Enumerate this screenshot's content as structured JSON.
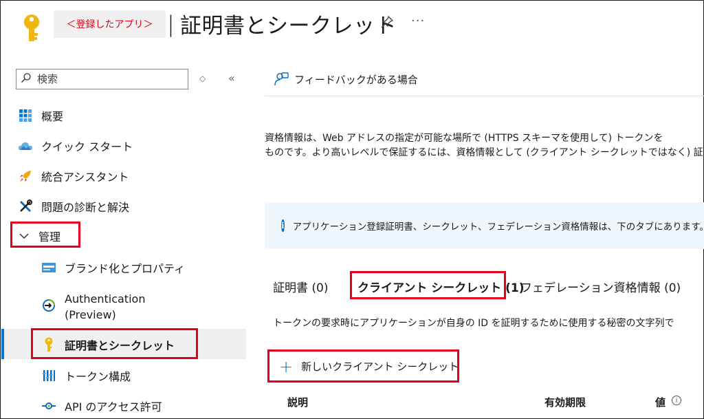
{
  "header": {
    "breadcrumb": "＜登録したアプリ＞",
    "separator": "|",
    "title": "証明書とシークレット",
    "more": "···"
  },
  "sidebar": {
    "search_placeholder": "検索",
    "updown": "◇",
    "collapse": "«",
    "items": [
      {
        "label": "概要",
        "icon": "grid-icon"
      },
      {
        "label": "クイック スタート",
        "icon": "cloud-icon"
      },
      {
        "label": "統合アシスタント",
        "icon": "rocket-icon"
      },
      {
        "label": "問題の診断と解決",
        "icon": "tools-icon"
      },
      {
        "label": "管理",
        "icon": "chevron-down-icon"
      },
      {
        "label": "ブランド化とプロパティ",
        "icon": "branding-icon"
      },
      {
        "label": "Authentication",
        "label2": "(Preview)",
        "icon": "authentication-icon"
      },
      {
        "label": "証明書とシークレット",
        "icon": "key-icon"
      },
      {
        "label": "トークン構成",
        "icon": "token-icon"
      },
      {
        "label": "API のアクセス許可",
        "icon": "api-icon"
      }
    ]
  },
  "main": {
    "feedback": "フィードバックがある場合",
    "description_line1": "資格情報は、Web アドレスの指定が可能な場所で (HTTPS スキーマを使用して) トークンを",
    "description_line2": "ものです。より高いレベルで保証するには、資格情報として (クライアント シークレットではなく) 証",
    "info": "アプリケーション登録証明書、シークレット、フェデレーション資格情報は、下のタブにあります。",
    "tabs": [
      {
        "label": "証明書 (0)"
      },
      {
        "label": "クライアント シークレット (1)"
      },
      {
        "label": "フェデレーション資格情報 (0)"
      }
    ],
    "tab_description": "トークンの要求時にアプリケーションが自身の ID を証明するために使用する秘密の文字列で",
    "new_secret": "新しいクライアント シークレット",
    "columns": [
      "説明",
      "有効期限",
      "値"
    ]
  },
  "colors": {
    "accent": "#0078d4",
    "highlight_box": "#e3001b",
    "info_bg": "#eff6fc",
    "key_gold": "#f2b70c"
  }
}
